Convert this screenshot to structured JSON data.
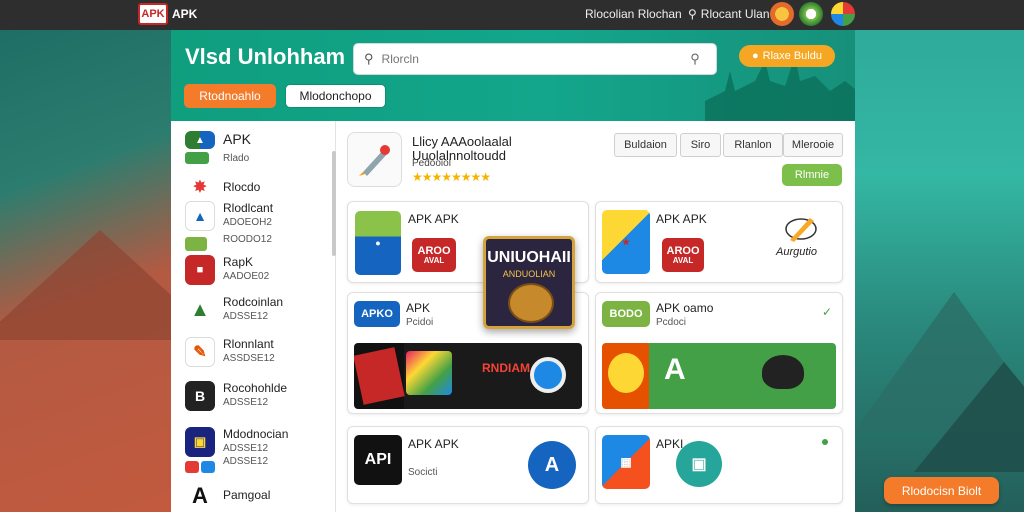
{
  "topbar": {
    "logo": "APK",
    "brand": "APK",
    "link": "Rlocolian Rlochan",
    "search_label": "Rlocant Ulan"
  },
  "header": {
    "title": "Vlsd Unlohham",
    "search_placeholder": "Rlorcln",
    "promo_label": "Rlaxe Buldu",
    "btn_primary": "Rtodnoahlo",
    "btn_secondary": "Mlodonchopo"
  },
  "sidebar": {
    "items": [
      {
        "name": "APK",
        "sub": "Rlado",
        "icon": "apk-icon"
      },
      {
        "name": "Rlocdo",
        "sub": "",
        "icon": "pinwheel-icon"
      },
      {
        "name": "Rlodlcant",
        "sub": "ADOEOH2",
        "sub2": "ROODO12",
        "icon": "triangle-logo-icon"
      },
      {
        "name": "RapK",
        "sub": "AADOE02",
        "icon": "red-box-icon"
      },
      {
        "name": "Rodcoinlan",
        "sub": "ADSSE12",
        "icon": "green-triangle-icon"
      },
      {
        "name": "Rlonnlant",
        "sub": "ASSDSE12",
        "icon": "pencil-icon"
      },
      {
        "name": "Rocohohlde",
        "sub": "ADSSE12",
        "icon": "b-icon"
      },
      {
        "name": "Mdodnocian",
        "sub": "ADSSE12",
        "sub2": "ADSSE12",
        "icon": "device-icon"
      },
      {
        "name": "Pamgoal",
        "sub": "",
        "icon": "a-letter-icon"
      }
    ]
  },
  "featured": {
    "title": "Llicy AAAoolaalal",
    "title2": "Uuolalnnoltoudd",
    "sub": "Pedooiol",
    "stars": "★★★★★★★★"
  },
  "chips": [
    "Buldaion",
    "Siro",
    "Rlanlon",
    "Mlerooie"
  ],
  "green_button": "Rlmnie",
  "cards": {
    "c1": {
      "label": "APK APK",
      "tile_text": "AROO",
      "tile_sub": "AVAL"
    },
    "c2": {
      "label": "APK APK",
      "tile_text": "AROO",
      "tile_sub": "AVAL",
      "logo": "Aurgutio"
    },
    "c3": {
      "label": "APK",
      "sub": "Pcidoi",
      "badge": "APKO",
      "banner": "RNDIAM"
    },
    "c4": {
      "label": "APK oamo",
      "sub": "Pcdoci",
      "badge": "BODO"
    },
    "c5": {
      "label": "APK APK",
      "sub": "Socicti",
      "badge": "API"
    },
    "c6": {
      "label": "APKI"
    }
  },
  "bigtile": {
    "title": "UNIUOHAII",
    "sub": "ANDUOLIAN"
  },
  "cta": "Rlodocisn Biolt",
  "colors": {
    "accent": "#13a68c",
    "orange": "#f37b2a",
    "green": "#7cbf4a"
  }
}
